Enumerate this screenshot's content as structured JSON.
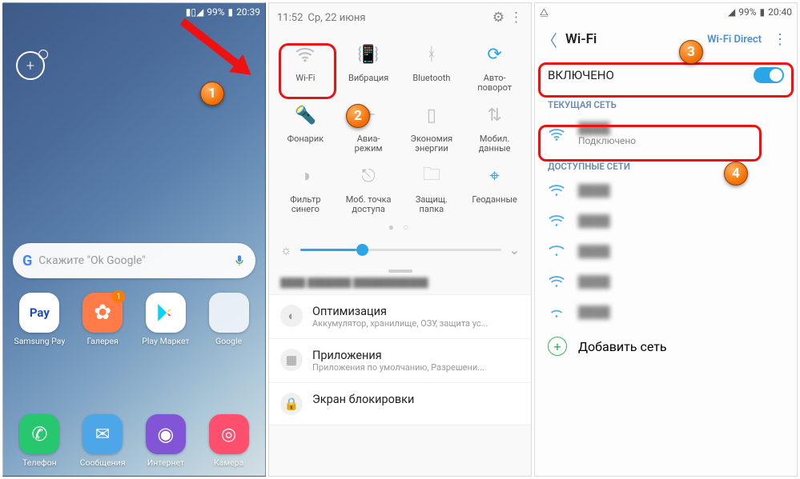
{
  "panel1": {
    "status": {
      "battery_pct": "99%",
      "time": "20:39"
    },
    "search_placeholder": "Скажите \"Ok Google\"",
    "apps_row1": [
      {
        "name": "Samsung Pay"
      },
      {
        "name": "Галерея",
        "badge": "1"
      },
      {
        "name": "Play Маркет"
      },
      {
        "name": "Google"
      }
    ],
    "apps_row2": [
      {
        "name": "Телефон"
      },
      {
        "name": "Сообщения"
      },
      {
        "name": "Интернет"
      },
      {
        "name": "Камера"
      }
    ],
    "marker": "1"
  },
  "panel2": {
    "time": "11:52",
    "date": "Ср, 22 июня",
    "tiles": [
      {
        "label": "Wi-Fi",
        "active": false,
        "icon": "wifi"
      },
      {
        "label": "Вибрация",
        "active": true,
        "icon": "vibrate"
      },
      {
        "label": "Bluetooth",
        "active": false,
        "icon": "bt"
      },
      {
        "label": "Авто-\nповорот",
        "active": true,
        "icon": "rotate"
      },
      {
        "label": "Фонарик",
        "active": false,
        "icon": "flash"
      },
      {
        "label": "Авиа-\nрежим",
        "active": false,
        "icon": "plane"
      },
      {
        "label": "Экономия\nэнергии",
        "active": false,
        "icon": "battery"
      },
      {
        "label": "Мобил.\nданные",
        "active": false,
        "icon": "data"
      },
      {
        "label": "Фильтр\nсинего",
        "active": false,
        "icon": "bluefilter"
      },
      {
        "label": "Моб. точка\nдоступа",
        "active": false,
        "icon": "hotspot"
      },
      {
        "label": "Защищ.\nпапка",
        "active": false,
        "icon": "secure"
      },
      {
        "label": "Геоданные",
        "active": true,
        "icon": "location"
      }
    ],
    "settings": [
      {
        "title": "Оптимизация",
        "sub": "Аккумулятор, хранилище, ОЗУ, защита ус..."
      },
      {
        "title": "Приложения",
        "sub": "Приложения по умолчанию, Разрешени..."
      },
      {
        "title": "Экран блокировки",
        "sub": ""
      }
    ],
    "marker": "2"
  },
  "panel3": {
    "status": {
      "battery_pct": "99%",
      "time": "20:40"
    },
    "title": "Wi-Fi",
    "direct": "Wi-Fi Direct",
    "toggle_label": "ВКЛЮЧЕНО",
    "sect_current": "ТЕКУЩАЯ СЕТЬ",
    "sect_avail": "ДОСТУПНЫЕ СЕТИ",
    "current": {
      "name": "████",
      "status": "Подключено"
    },
    "available": [
      "████",
      "████",
      "████",
      "████",
      "████"
    ],
    "add_label": "Добавить сеть",
    "marker3": "3",
    "marker4": "4"
  }
}
